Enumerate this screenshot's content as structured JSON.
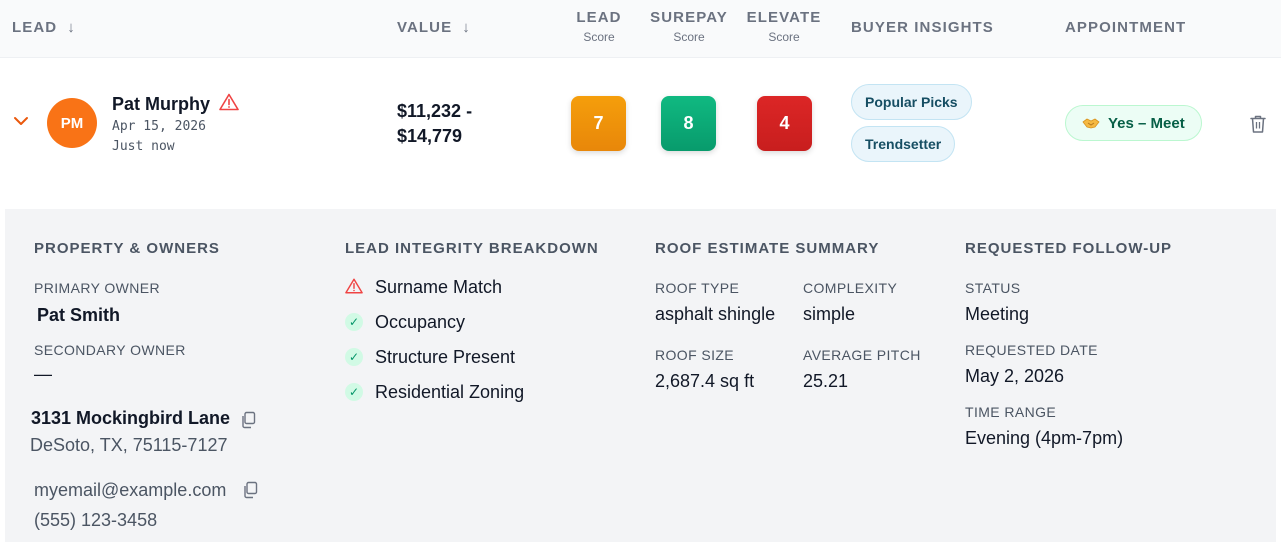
{
  "header": {
    "lead": "LEAD",
    "lead_arrow": "↓",
    "value": "VALUE",
    "value_arrow": "↓",
    "lead_score": {
      "title": "LEAD",
      "sub": "Score"
    },
    "surepay_score": {
      "title": "SUREPAY",
      "sub": "Score"
    },
    "elevate_score": {
      "title": "ELEVATE",
      "sub": "Score"
    },
    "buyer_insights": "BUYER INSIGHTS",
    "appointment": "APPOINTMENT"
  },
  "lead": {
    "initials": "PM",
    "name": "Pat Murphy",
    "date": "Apr 15, 2026",
    "updated": "Just now",
    "value_low": "$11,232 -",
    "value_high": "$14,779",
    "scores": {
      "lead": "7",
      "surepay": "8",
      "elevate": "4"
    },
    "insights": [
      "Popular Picks",
      "Trendsetter"
    ],
    "appointment": "Yes – Meet"
  },
  "colors": {
    "avatar": "#f97316",
    "lead_score": "#f59e0b",
    "surepay_score": "#10b981",
    "elevate_score": "#dc2626",
    "warning": "#ef4444",
    "check": "#059669"
  },
  "details": {
    "property": {
      "heading": "PROPERTY & OWNERS",
      "primary_label": "PRIMARY OWNER",
      "primary_value": "Pat Smith",
      "secondary_label": "SECONDARY OWNER",
      "secondary_value": "—",
      "address_line1": "3131 Mockingbird Lane",
      "address_line2": "DeSoto, TX, 75115-7127",
      "email": "myemail@example.com",
      "phone": "(555) 123-3458"
    },
    "integrity": {
      "heading": "LEAD INTEGRITY BREAKDOWN",
      "items": [
        {
          "label": "Surname Match",
          "status": "warning"
        },
        {
          "label": "Occupancy",
          "status": "pass"
        },
        {
          "label": "Structure Present",
          "status": "pass"
        },
        {
          "label": "Residential Zoning",
          "status": "pass"
        }
      ],
      "check_glyph": "✓"
    },
    "roof": {
      "heading": "ROOF ESTIMATE SUMMARY",
      "type_label": "ROOF TYPE",
      "type_value": "asphalt shingle",
      "complexity_label": "COMPLEXITY",
      "complexity_value": "simple",
      "size_label": "ROOF SIZE",
      "size_value": "2,687.4 sq ft",
      "pitch_label": "AVERAGE PITCH",
      "pitch_value": "25.21"
    },
    "followup": {
      "heading": "REQUESTED FOLLOW-UP",
      "status_label": "STATUS",
      "status_value": "Meeting",
      "date_label": "REQUESTED DATE",
      "date_value": "May 2, 2026",
      "range_label": "TIME RANGE",
      "range_value": "Evening (4pm-7pm)"
    }
  }
}
